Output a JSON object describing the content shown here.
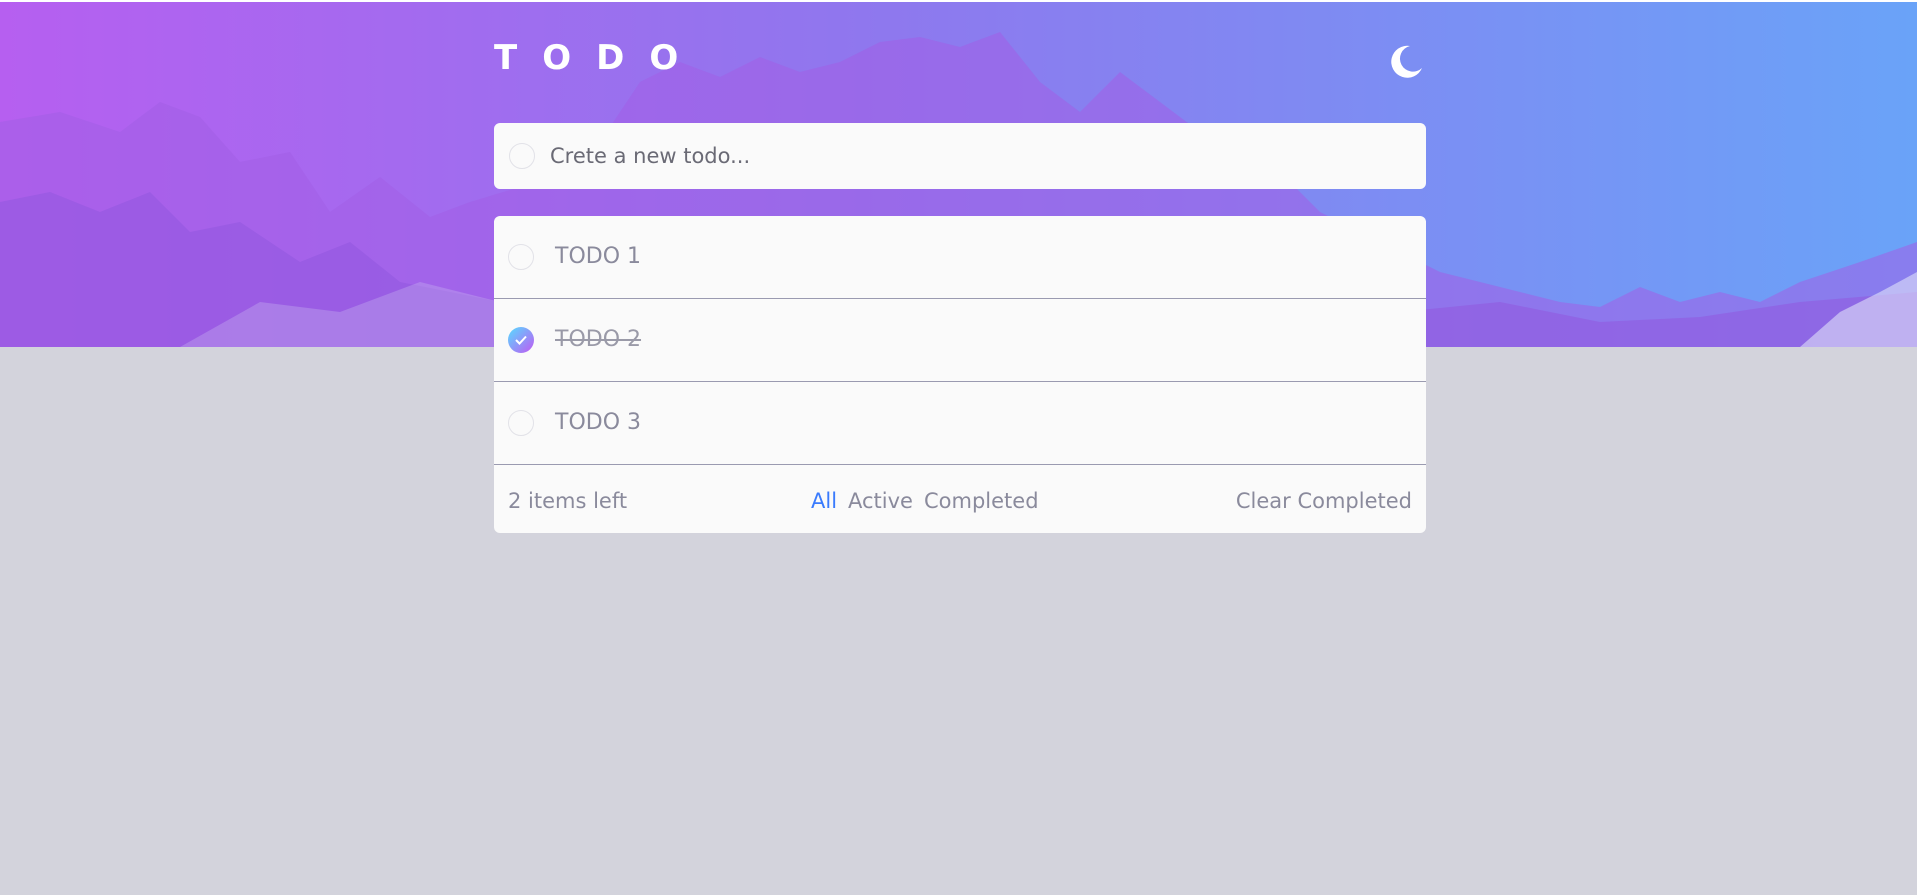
{
  "app": {
    "title": "TODO",
    "theme_icon": "moon-icon"
  },
  "new_todo": {
    "placeholder": "Crete a new todo..."
  },
  "todos": [
    {
      "label": "TODO 1",
      "completed": false
    },
    {
      "label": "TODO 2",
      "completed": true
    },
    {
      "label": "TODO 3",
      "completed": false
    }
  ],
  "footer": {
    "items_left": "2 items left",
    "filters": {
      "all": "All",
      "active": "Active",
      "completed": "Completed"
    },
    "active_filter": "All",
    "clear_completed": "Clear Completed"
  },
  "colors": {
    "accent": "#3a7bfd",
    "gradient_start": "#57ddff",
    "gradient_end": "#c058f3",
    "page_bg": "#d3d3dc"
  }
}
